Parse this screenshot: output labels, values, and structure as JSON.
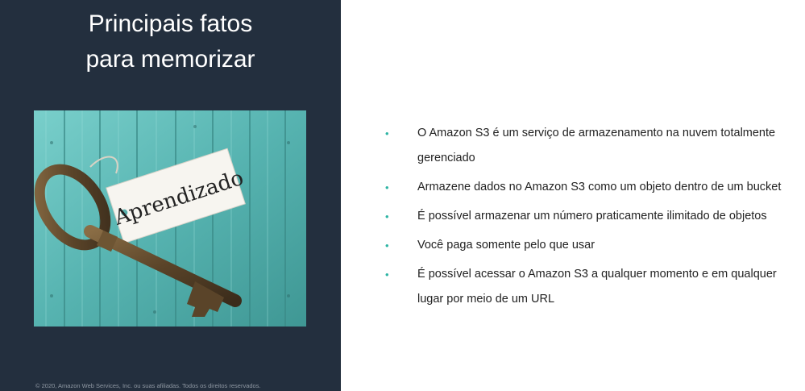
{
  "slide": {
    "title_line1": "Principais fatos",
    "title_line2": "para memorizar",
    "image_tag_text": "Aprendizado",
    "copyright": "© 2020, Amazon Web Services, Inc. ou suas afiliadas. Todos os direitos reservados.",
    "bullet_glyph": "•",
    "bullets": [
      "O Amazon S3 é um serviço de armazenamento na nuvem totalmente gerenciado",
      "Armazene dados no Amazon S3 como um objeto dentro de um bucket",
      "É possível armazenar um número praticamente ilimitado de objetos",
      "Você paga somente pelo que usar",
      "É possível acessar o Amazon S3 a qualquer momento e em qualquer lugar por meio de um URL"
    ]
  },
  "colors": {
    "left_panel_bg": "#232f3e",
    "bullet_accent": "#2fb5a5",
    "wood_teal": "#5fb8b5"
  }
}
